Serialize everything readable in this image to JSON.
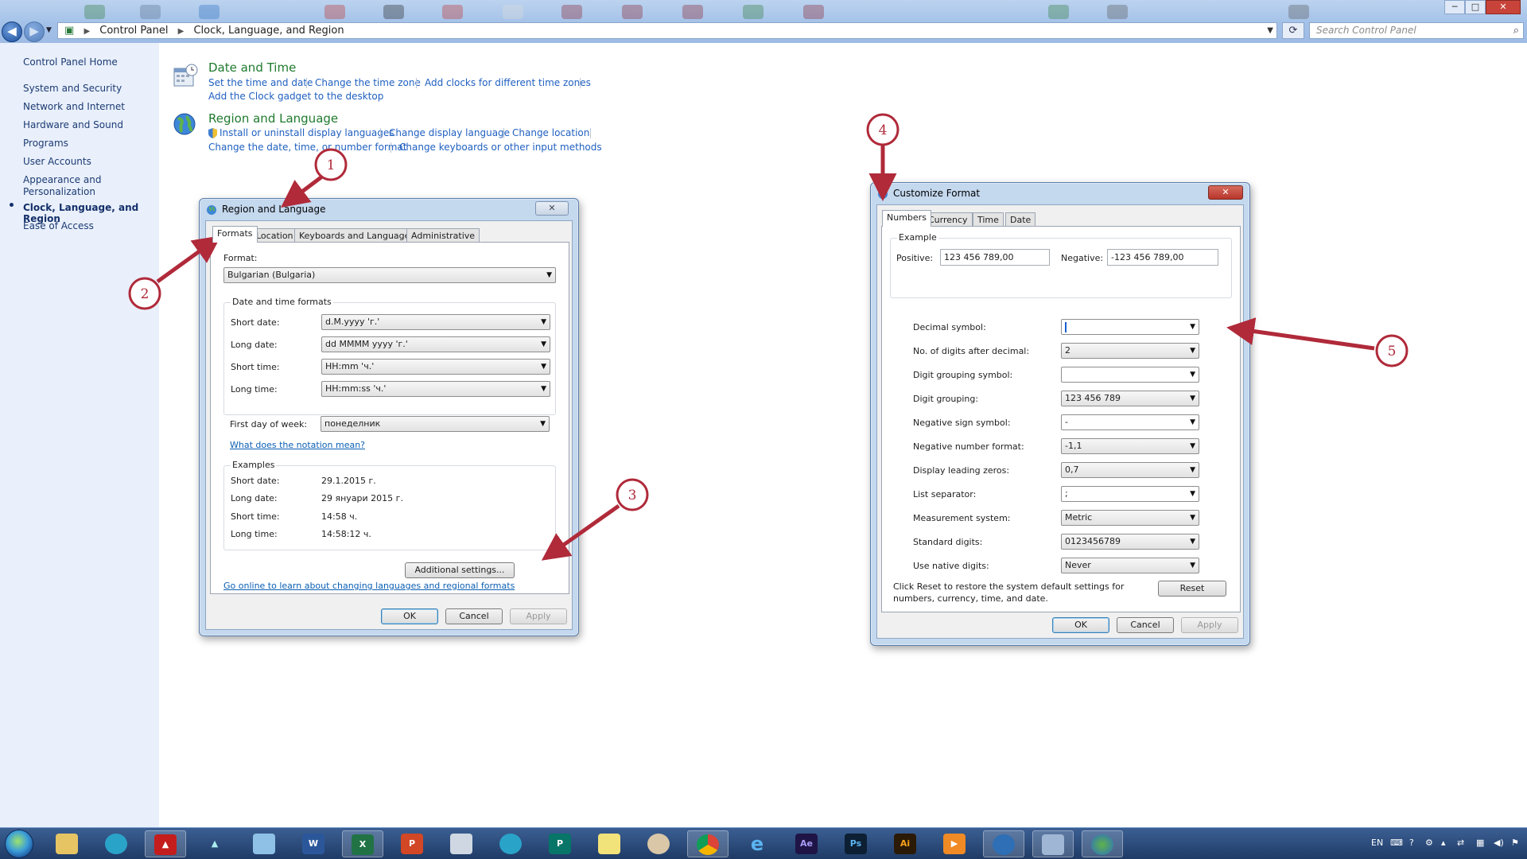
{
  "window": {
    "breadcrumb": [
      "Control Panel",
      "Clock, Language, and Region"
    ],
    "search_placeholder": "Search Control Panel",
    "controls": [
      "─",
      "□",
      "✕"
    ]
  },
  "sidebar": {
    "home": "Control Panel Home",
    "items": [
      "System and Security",
      "Network and Internet",
      "Hardware and Sound",
      "Programs",
      "User Accounts",
      "Appearance and",
      "Personalization",
      "Clock, Language, and Region",
      "Ease of Access"
    ]
  },
  "categories": [
    {
      "title": "Date and Time",
      "links_row1": [
        "Set the time and date",
        "Change the time zone",
        "Add clocks for different time zones"
      ],
      "links_row2": [
        "Add the Clock gadget to the desktop"
      ]
    },
    {
      "title": "Region and Language",
      "links_row1": [
        "Install or uninstall display languages",
        "Change display language",
        "Change location"
      ],
      "links_row2": [
        "Change the date, time, or number format",
        "Change keyboards or other input methods"
      ]
    }
  ],
  "region_dialog": {
    "title": "Region and Language",
    "close": "✕",
    "tabs": [
      "Formats",
      "Location",
      "Keyboards and Languages",
      "Administrative"
    ],
    "format_label": "Format:",
    "format_value": "Bulgarian (Bulgaria)",
    "dt_group": "Date and time formats",
    "fields": [
      {
        "label": "Short date:",
        "value": "d.M.yyyy 'г.'"
      },
      {
        "label": "Long date:",
        "value": "dd MMMM yyyy 'г.'"
      },
      {
        "label": "Short time:",
        "value": "HH:mm 'ч.'"
      },
      {
        "label": "Long time:",
        "value": "HH:mm:ss 'ч.'"
      },
      {
        "label": "First day of week:",
        "value": "понеделник"
      }
    ],
    "notation_link": "What does the notation mean?",
    "examples_group": "Examples",
    "examples": [
      {
        "label": "Short date:",
        "value": "29.1.2015 г."
      },
      {
        "label": "Long date:",
        "value": "29 януари 2015 г."
      },
      {
        "label": "Short time:",
        "value": "14:58 ч."
      },
      {
        "label": "Long time:",
        "value": "14:58:12 ч."
      }
    ],
    "additional_button": "Additional settings...",
    "online_link": "Go online to learn about changing languages and regional formats",
    "ok": "OK",
    "cancel": "Cancel",
    "apply": "Apply"
  },
  "customize_dialog": {
    "title": "Customize Format",
    "close": "✕",
    "tabs": [
      "Numbers",
      "Currency",
      "Time",
      "Date"
    ],
    "example_group": "Example",
    "positive_label": "Positive:",
    "positive_value": "123 456 789,00",
    "negative_label": "Negative:",
    "negative_value": "-123 456 789,00",
    "settings": [
      {
        "label": "Decimal symbol:",
        "value": ""
      },
      {
        "label": "No. of digits after decimal:",
        "value": "2"
      },
      {
        "label": "Digit grouping symbol:",
        "value": ""
      },
      {
        "label": "Digit grouping:",
        "value": "123 456 789"
      },
      {
        "label": "Negative sign symbol:",
        "value": "-"
      },
      {
        "label": "Negative number format:",
        "value": "-1,1"
      },
      {
        "label": "Display leading zeros:",
        "value": "0,7"
      },
      {
        "label": "List separator:",
        "value": ";"
      },
      {
        "label": "Measurement system:",
        "value": "Metric"
      },
      {
        "label": "Standard digits:",
        "value": "0123456789"
      },
      {
        "label": "Use native digits:",
        "value": "Never"
      }
    ],
    "reset_note_1": "Click Reset to restore the system default settings for",
    "reset_note_2": "numbers, currency, time, and date.",
    "reset": "Reset",
    "ok": "OK",
    "cancel": "Cancel",
    "apply": "Apply"
  },
  "annotations": [
    "1",
    "2",
    "3",
    "4",
    "5"
  ],
  "taskbar": {
    "apps": [
      "Windows Explorer",
      "app-2",
      "Acrobat",
      "app-4",
      "app-5",
      "W",
      "X",
      "P",
      "app-9",
      "app-10",
      "P",
      "app-12",
      "app-13",
      "Chrome",
      "Internet Explorer",
      "Ae",
      "Ps",
      "Ai",
      "app-19",
      "app-20",
      "Control Panel",
      "Region and Language"
    ],
    "tray": {
      "lang": "EN"
    }
  },
  "colors": {
    "annotation": "#b02a3a",
    "link": "#2060c0",
    "category_title": "#1f7a2e"
  }
}
